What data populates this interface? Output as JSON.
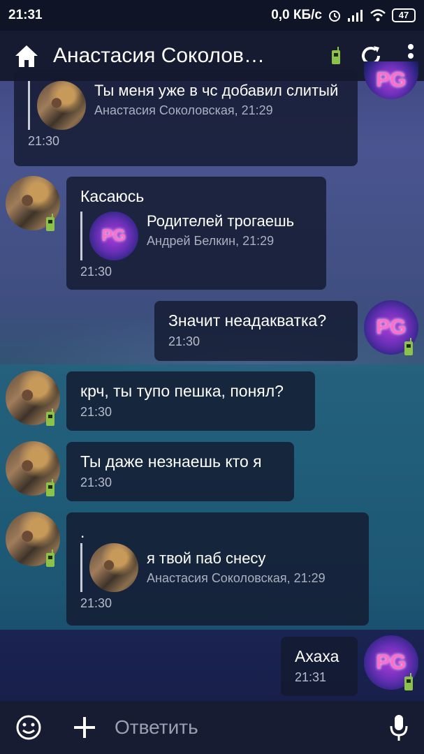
{
  "status_bar": {
    "time": "21:31",
    "network_speed": "0,0 КБ/с",
    "battery": "47"
  },
  "header": {
    "title": "Анастасия Соколов…",
    "icons": [
      "home-icon",
      "walkie-talkie-icon",
      "refresh-icon",
      "more-vert-icon"
    ]
  },
  "messages": [
    {
      "quote": {
        "text": "Ты меня уже в чс добавил слитый",
        "meta": "Анастасия Соколовская, 21:29"
      },
      "time": "21:30"
    },
    {
      "text": "Касаюсь",
      "quote": {
        "text": "Родителей трогаешь",
        "meta": "Андрей Белкин, 21:29"
      },
      "time": "21:30"
    },
    {
      "text": "Значит неадакватка?",
      "time": "21:30"
    },
    {
      "text": "крч, ты тупо пешка, понял?",
      "time": "21:30"
    },
    {
      "text": "Ты даже незнаешь кто я",
      "time": "21:30"
    },
    {
      "text": ".",
      "quote": {
        "text": "я твой паб снесу",
        "meta": "Анастасия Соколовская, 21:29"
      },
      "time": "21:30"
    },
    {
      "text": "Ахаха",
      "time": "21:31"
    }
  ],
  "avatar_labels": {
    "pg": "PG"
  },
  "composer": {
    "placeholder": "Ответить"
  },
  "colors": {
    "online_indicator": "#8bc34a",
    "bubble_bg": "#141a30"
  }
}
